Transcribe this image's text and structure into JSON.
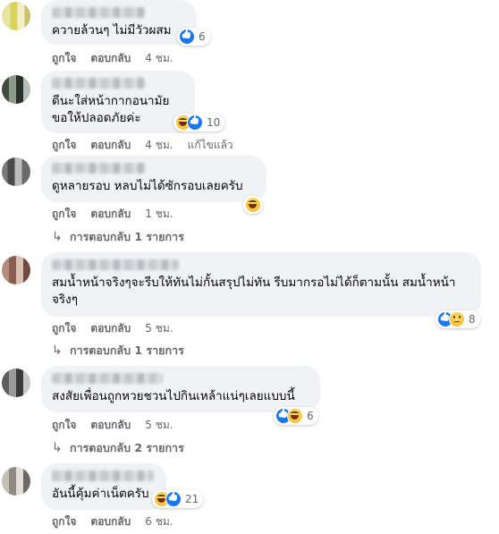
{
  "labels": {
    "like": "ถูกใจ",
    "reply": "ตอบกลับ"
  },
  "comments": [
    {
      "text": "ควายล้วนๆ ไม่มีวัวผสม",
      "reactions": [
        "like-icon"
      ],
      "reaction_count": "6",
      "time": "4 ชม."
    },
    {
      "text": "ดีนะใส่หน้ากากอนามัย ขอให้ปลอดภัยค่ะ",
      "reactions": [
        "haha-icon",
        "like-icon"
      ],
      "reaction_count": "10",
      "time": "4 ชม.",
      "edited": "แก้ไขแล้ว"
    },
    {
      "text": "ดูหลายรอบ หลบไม่ได้ซักรอบเลยครับ",
      "reactions": [
        "haha-icon"
      ],
      "reaction_count": "",
      "time": "1 ชม.",
      "replies": "การตอบกลับ 1 รายการ"
    },
    {
      "text": "สมน้ำหน้าจริงๆจะรีบให้ทันไม่กั้นสรุปไม่ทัน รีบมากรอไม่ได้ก็ตามนั้น สมน้ำหน้า จริงๆ",
      "reactions": [
        "like-icon",
        "sad-icon"
      ],
      "reaction_count": "8",
      "time": "5 ชม.",
      "replies": "การตอบกลับ 1 รายการ"
    },
    {
      "text": "สงสัยเพื่อนถูกหวยชวนไปกินเหล้าแน่ๆเลยแบบนี้",
      "reactions": [
        "like-icon",
        "haha-icon"
      ],
      "reaction_count": "6",
      "time": "5 ชม.",
      "replies": "การตอบกลับ 2 รายการ"
    },
    {
      "text": "อันนี้คุ้มค่าเน็ตครับ",
      "reactions": [
        "haha-icon",
        "like-icon"
      ],
      "reaction_count": "21",
      "time": "6 ชม."
    }
  ]
}
